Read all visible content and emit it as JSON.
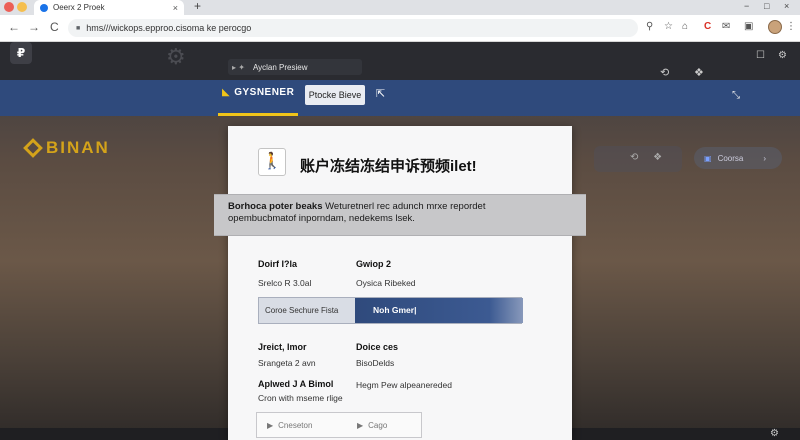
{
  "browser": {
    "tab_title": "Oeerx 2 Proek",
    "tab_close": "×",
    "new_tab": "+",
    "url": "hms///wickops.epproo.cisoma                         ke perocgo",
    "nav_back": "←",
    "nav_forward": "→",
    "nav_reload": "C",
    "window_controls": [
      "−",
      "□",
      "×"
    ],
    "toolbar_icons": [
      "⚲",
      "☆",
      "⌂",
      "C",
      "✉",
      "▣",
      "⋮"
    ],
    "colors": {
      "close": "#ec5f57",
      "minimize": "#f5bf4f",
      "maximize": "#61c454"
    }
  },
  "site": {
    "logo_glyph": "₽",
    "preview_label": "Ayclan Presiew",
    "preview_dots": "▸ ✦",
    "top_right_icons": [
      "⟲",
      "❖"
    ],
    "nav_brand": "GYSNENER",
    "nav_pill": "Ptocke Bieve",
    "nav_ext_icon": "⇱",
    "nav_chevron": "⤡",
    "brand_name": "BINAN",
    "right_btn_label": "Coorsa",
    "right_btn_icon": "▣",
    "right_btn_chev": "›",
    "right_icons": "⟲ ❖",
    "colors": {
      "brand_gold": "#d4a31a",
      "nav_blue": "#2f4a7c"
    }
  },
  "dialog": {
    "title_icon": "🚶",
    "title": "账户冻结冻结申诉预频ilet!",
    "banner_bold": "Borhoca poter beaks",
    "banner_line1": " Weturetnerl rec adunch mrxe repordet",
    "banner_line2": "opembucbmatof inporndam, nedekems lsek.",
    "fields": {
      "f1_label": "Doirf I?la",
      "f1_value": "Srelco R 3.0al",
      "f2_label": "Gwiop 2",
      "f2_value": "Oysica Ribeked",
      "f3_label": "Jreict, Imor",
      "f3_value": "Srangeta 2 avn",
      "f4_label": "Doice ces",
      "f4_value": "BisoDelds",
      "f5_label": "Aplwed J A Bimol",
      "f5_value": "Cron with mseme rlige",
      "f6_value": "Hegm Pew alpeanereded"
    },
    "progress": {
      "left_label": "Coroe Sechure Fista",
      "center_label": "Noh Gmer|",
      "fill_fraction": 1.0
    },
    "footer": {
      "btn1_icon": "▶",
      "btn1_label": "Cneseton",
      "btn2_icon": "▶",
      "btn2_label": "Cago"
    }
  },
  "bottom_gear": "⚙"
}
